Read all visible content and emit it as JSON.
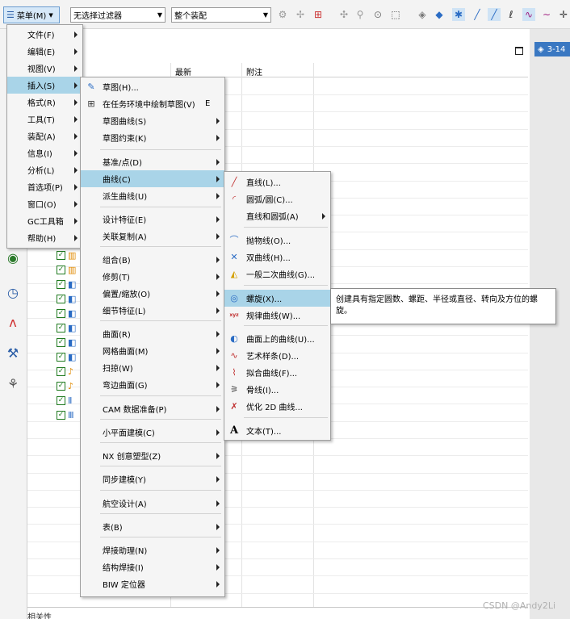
{
  "toolbar": {
    "menu_label": "菜单(M)",
    "filter_value": "无选择过滤器",
    "scope_value": "整个装配",
    "icons": [
      "constraint-icon",
      "snap-icon",
      "point-dialog-icon",
      "pattern-icon",
      "select-feature-icon",
      "select-box-icon",
      "view-icon",
      "solid-icon",
      "snap-points-icon",
      "line-icon",
      "line-icon",
      "spline-icon",
      "curve-icon",
      "wave-icon",
      "cross-icon"
    ]
  },
  "window_tab": "3-14",
  "main_menu": {
    "items": [
      {
        "label": "文件(F)"
      },
      {
        "label": "编辑(E)"
      },
      {
        "label": "视图(V)"
      },
      {
        "label": "插入(S)"
      },
      {
        "label": "格式(R)"
      },
      {
        "label": "工具(T)"
      },
      {
        "label": "装配(A)"
      },
      {
        "label": "信息(I)"
      },
      {
        "label": "分析(L)"
      },
      {
        "label": "首选项(P)"
      },
      {
        "label": "窗口(O)"
      },
      {
        "label": "GC工具箱"
      },
      {
        "label": "帮助(H)"
      }
    ]
  },
  "insert_menu": {
    "items": [
      {
        "label": "草图(H)..."
      },
      {
        "label": "在任务环境中绘制草图(V)",
        "shortcut": "E"
      },
      {
        "label": "草图曲线(S)"
      },
      {
        "label": "草图约束(K)"
      },
      {
        "label": "基准/点(D)"
      },
      {
        "label": "曲线(C)"
      },
      {
        "label": "派生曲线(U)"
      },
      {
        "label": "设计特征(E)"
      },
      {
        "label": "关联复制(A)"
      },
      {
        "label": "组合(B)"
      },
      {
        "label": "修剪(T)"
      },
      {
        "label": "偏置/缩放(O)"
      },
      {
        "label": "细节特征(L)"
      },
      {
        "label": "曲面(R)"
      },
      {
        "label": "网格曲面(M)"
      },
      {
        "label": "扫掠(W)"
      },
      {
        "label": "弯边曲面(G)"
      },
      {
        "label": "CAM 数据准备(P)"
      },
      {
        "label": "小平面建模(C)"
      },
      {
        "label": "NX 创意塑型(Z)"
      },
      {
        "label": "同步建模(Y)"
      },
      {
        "label": "航空设计(A)"
      },
      {
        "label": "表(B)"
      },
      {
        "label": "焊接助理(N)"
      },
      {
        "label": "结构焊接(I)"
      },
      {
        "label": "BIW 定位器"
      }
    ]
  },
  "curve_menu": {
    "items": [
      {
        "label": "直线(L)..."
      },
      {
        "label": "圆弧/圆(C)..."
      },
      {
        "label": "直线和圆弧(A)"
      },
      {
        "label": "抛物线(O)..."
      },
      {
        "label": "双曲线(H)..."
      },
      {
        "label": "一般二次曲线(G)..."
      },
      {
        "label": "螺旋(X)..."
      },
      {
        "label": "规律曲线(W)..."
      },
      {
        "label": "曲面上的曲线(U)..."
      },
      {
        "label": "艺术样条(D)..."
      },
      {
        "label": "拟合曲线(F)..."
      },
      {
        "label": "骨线(I)..."
      },
      {
        "label": "优化 2D 曲线..."
      },
      {
        "label": "文本(T)..."
      }
    ]
  },
  "tooltip": {
    "line1": "创建具有指定圆数、螺距、半径或直径、转向及方位的螺",
    "line2": "旋。"
  },
  "table": {
    "headers": [
      "最新",
      "附注"
    ]
  },
  "bottom_label": "相关性",
  "watermark": "CSDN @Andy2Li"
}
